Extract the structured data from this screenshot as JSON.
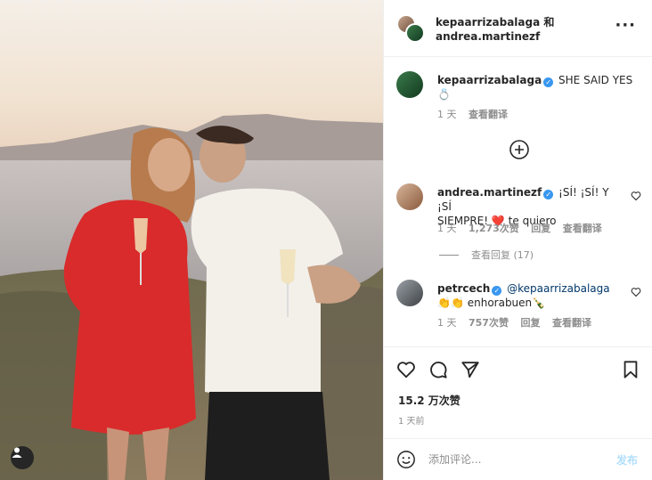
{
  "header": {
    "names": "kepaarrizabalaga 和",
    "names_line2": "andrea.martinezf",
    "more_icon": "more-horizontal-icon"
  },
  "caption": {
    "username": "kepaarrizabalaga",
    "text": "SHE SAID YES",
    "emoji": "💍",
    "time": "1 天",
    "translate": "查看翻译"
  },
  "comments": [
    {
      "username": "andrea.martinezf",
      "text_line1": "¡SÍ! ¡SÍ! Y ¡SÍ",
      "text_line2": "SIEMPRE!",
      "emoji": "❤️",
      "text_end": "te quiero",
      "time": "1 天",
      "likes": "1,273次赞",
      "reply": "回复",
      "translate": "查看翻译",
      "view_replies": "查看回复 (17)"
    },
    {
      "username": "petrcech",
      "mention": "@kepaarrizabalaga",
      "emoji": "👏👏",
      "text": "enhorabuen",
      "emoji_end": "🍾",
      "time": "1 天",
      "likes": "757次赞",
      "reply": "回复",
      "translate": "查看翻译"
    }
  ],
  "stats": {
    "likes": "15.2 万次赞",
    "posted": "1 天前"
  },
  "composer": {
    "placeholder": "添加评论...",
    "post_label": "发布"
  },
  "colors": {
    "verified": "#3897f0",
    "post_disabled": "#b2dffc",
    "secondary_text": "#8e8e8e",
    "dress": "#d92b2b"
  }
}
